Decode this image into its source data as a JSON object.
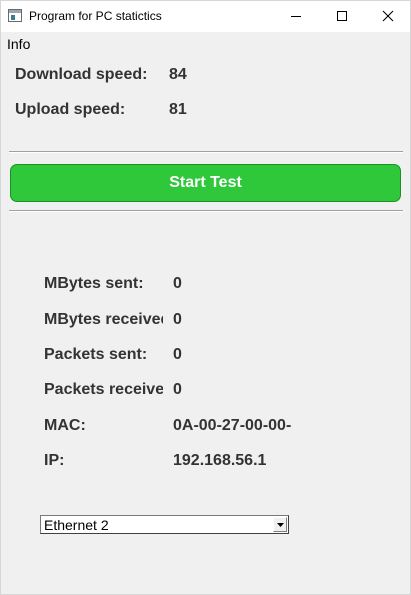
{
  "window": {
    "title": "Program for PC statictics"
  },
  "menu": {
    "info": "Info"
  },
  "speed": {
    "download_label": "Download speed:",
    "download_value": "84",
    "upload_label": "Upload speed:",
    "upload_value": "81"
  },
  "start_button_label": "Start Test",
  "stats": {
    "mbytes_sent_label": "MBytes sent:",
    "mbytes_sent_value": "0",
    "mbytes_received_label": "MBytes received",
    "mbytes_received_value": "0",
    "packets_sent_label": "Packets sent:",
    "packets_sent_value": "0",
    "packets_received_label": "Packets received",
    "packets_received_value": "0",
    "mac_label": "MAC:",
    "mac_value": "0A-00-27-00-00-",
    "ip_label": "IP:",
    "ip_value": "192.168.56.1"
  },
  "adapter_select": {
    "selected": "Ethernet 2"
  },
  "colors": {
    "start_button": "#2ec83a",
    "window_bg": "#f0f0f0"
  },
  "icons": {
    "app": "app-window-icon",
    "minimize": "minimize-icon",
    "maximize": "maximize-icon",
    "close": "close-icon",
    "dropdown": "chevron-down-icon"
  }
}
